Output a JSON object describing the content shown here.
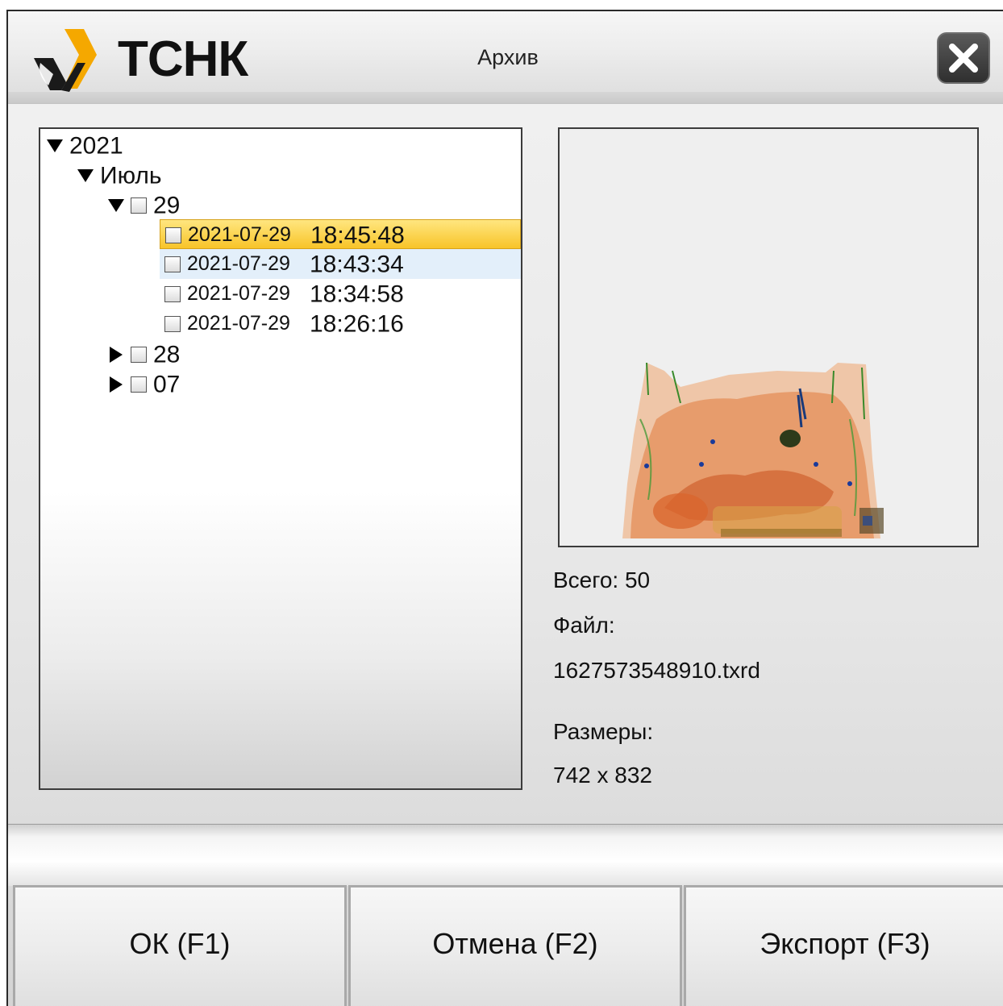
{
  "app": {
    "logo_text": "ТСНК",
    "title": "Архив"
  },
  "tree": {
    "year": "2021",
    "month": "Июль",
    "days": [
      {
        "label": "29",
        "expanded": true,
        "entries": [
          {
            "date": "2021-07-29",
            "time": "18:45:48",
            "state": "selected"
          },
          {
            "date": "2021-07-29",
            "time": "18:43:34",
            "state": "hover"
          },
          {
            "date": "2021-07-29",
            "time": "18:34:58",
            "state": "normal"
          },
          {
            "date": "2021-07-29",
            "time": "18:26:16",
            "state": "normal"
          }
        ]
      },
      {
        "label": "28",
        "expanded": false
      },
      {
        "label": "07",
        "expanded": false
      }
    ]
  },
  "info": {
    "total": "Всего: 50",
    "file_label": "Файл:",
    "file_name": "1627573548910.txrd",
    "size_label": "Размеры:",
    "size_value": "742 x 832"
  },
  "buttons": {
    "ok": "ОК (F1)",
    "cancel": "Отмена (F2)",
    "export": "Экспорт (F3)"
  },
  "colors": {
    "selection": "#f8c428",
    "hover": "#e3effa",
    "logo_accent": "#f5a800"
  },
  "icons": {
    "close": "close-icon",
    "logo": "tsnk-logo-icon"
  }
}
